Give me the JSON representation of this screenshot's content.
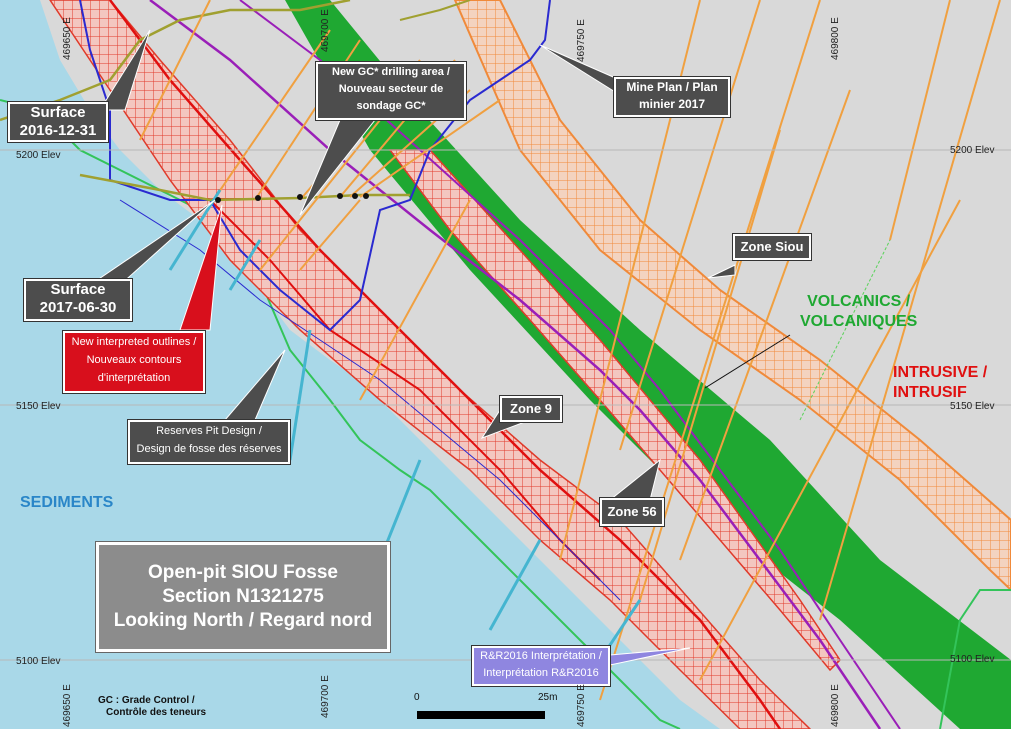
{
  "title": {
    "line1": "Open-pit SIOU Fosse",
    "line2": "Section N1321275",
    "line3": "Looking North / Regard nord"
  },
  "callouts": {
    "surface_2016": [
      "Surface",
      "2016-12-31"
    ],
    "surface_2017": [
      "Surface",
      "2017-06-30"
    ],
    "gc_area": [
      "New GC* drilling area /",
      "Nouveau secteur  de",
      "sondage GC*"
    ],
    "mine_plan": [
      "Mine Plan / Plan",
      "minier 2017"
    ],
    "new_outlines": [
      "New interpreted outlines /",
      "Nouveaux contours",
      "d'interprétation"
    ],
    "reserves_pit": [
      "Reserves Pit Design /",
      "Design de fosse des réserves"
    ],
    "zone_siou": "Zone Siou",
    "zone_9": "Zone 9",
    "zone_56": "Zone 56",
    "rr2016": [
      "R&R2016 Interprétation /",
      "Interprétation R&R2016"
    ]
  },
  "lithology": {
    "volcanics": [
      "VOLCANICS /",
      "VOLCANIQUES"
    ],
    "intrusive": [
      "INTRUSIVE /",
      "INTRUSIF"
    ],
    "sediments": "SEDIMENTS"
  },
  "elevation_labels": {
    "left": [
      "5200 Elev",
      "5150 Elev",
      "5100 Elev"
    ],
    "right": [
      "5200 Elev",
      "5150 Elev",
      "5100 Elev"
    ]
  },
  "easting_labels": {
    "top": [
      "469650 E",
      "469700 E",
      "469750 E",
      "469800 E"
    ],
    "bottom": [
      "469650 E",
      "469700 E",
      "469750 E",
      "469800 E"
    ]
  },
  "scale": {
    "start": "0",
    "end": "25m"
  },
  "footnote": [
    "GC : Grade Control /",
    "Contrôle des teneurs"
  ],
  "colors": {
    "sediments": "#a9d8e8",
    "background": "#d9d9d9",
    "volcanics_band": "#1fa832",
    "zone_hatch": "#e03a2a",
    "siou_hatch": "#f08a3a",
    "pit_design": "#2a2ad0",
    "mine_plan": "#9a1fb8",
    "callout_gray": "#4d4d4d",
    "callout_red": "#d80f1c",
    "label_green": "#1fa832",
    "label_red": "#e01010",
    "label_blue": "#2a86c8"
  }
}
